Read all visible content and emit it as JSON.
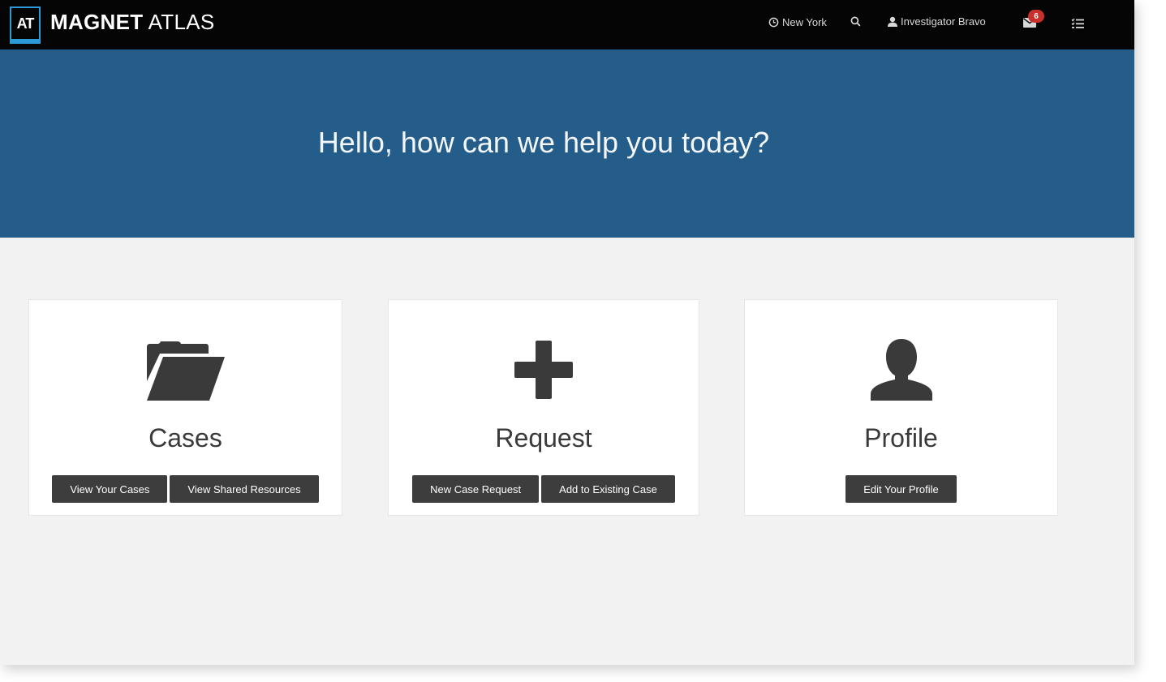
{
  "header": {
    "logo_text": "AT",
    "brand_bold": "MAGNET",
    "brand_light": "ATLAS",
    "location": "New York",
    "user": "Investigator Bravo",
    "notification_count": "6"
  },
  "hero": {
    "greeting": "Hello, how can we help you today?"
  },
  "cards": {
    "cases": {
      "icon": "folder-open-icon",
      "title": "Cases",
      "buttons": [
        "View Your Cases",
        "View Shared Resources"
      ]
    },
    "request": {
      "icon": "plus-icon",
      "title": "Request",
      "buttons": [
        "New Case Request",
        "Add to Existing Case"
      ]
    },
    "profile": {
      "icon": "user-icon",
      "title": "Profile",
      "buttons": [
        "Edit Your Profile"
      ]
    }
  },
  "colors": {
    "topbar": "#050505",
    "hero": "#245c8a",
    "background": "#f2f2f2",
    "button": "#3d3d3d",
    "accent": "#2c9ad6",
    "badge": "#c9302c"
  }
}
